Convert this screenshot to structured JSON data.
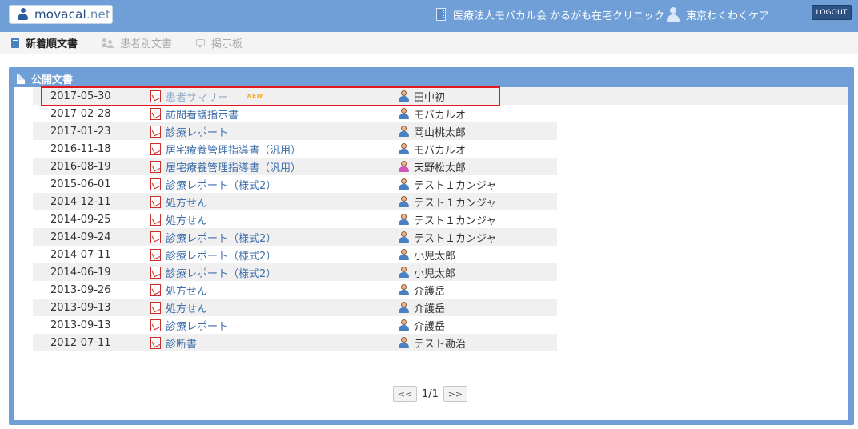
{
  "header": {
    "logo": {
      "name": "movacal",
      "dot": ".",
      "tld": "net"
    },
    "clinic_name": "医療法人モバカル会 かるがも在宅クリニック",
    "user_name": "東京わくわくケア",
    "logout_label": "LOGOUT"
  },
  "nav": {
    "tabs": [
      {
        "label": "新着順文書",
        "active": true,
        "icon": "document-icon"
      },
      {
        "label": "患者別文書",
        "active": false,
        "icon": "people-icon"
      },
      {
        "label": "掲示板",
        "active": false,
        "icon": "speech-bubble-icon"
      }
    ]
  },
  "panel": {
    "title": "公開文書"
  },
  "documents": [
    {
      "date": "2017-05-30",
      "title": "患者サマリー",
      "new": true,
      "badge": "NEW",
      "patient": "田中初",
      "gender": "male",
      "highlighted": true
    },
    {
      "date": "2017-02-28",
      "title": "訪問看護指示書",
      "new": false,
      "patient": "モバカルオ",
      "gender": "male"
    },
    {
      "date": "2017-01-23",
      "title": "診療レポート",
      "new": false,
      "patient": "岡山桃太郎",
      "gender": "male"
    },
    {
      "date": "2016-11-18",
      "title": "居宅療養管理指導書（汎用）",
      "new": false,
      "patient": "モバカルオ",
      "gender": "male"
    },
    {
      "date": "2016-08-19",
      "title": "居宅療養管理指導書（汎用）",
      "new": false,
      "patient": "天野松太郎",
      "gender": "female"
    },
    {
      "date": "2015-06-01",
      "title": "診療レポート（様式2）",
      "new": false,
      "patient": "テスト１カンジャ",
      "gender": "male"
    },
    {
      "date": "2014-12-11",
      "title": "処方せん",
      "new": false,
      "patient": "テスト１カンジャ",
      "gender": "male"
    },
    {
      "date": "2014-09-25",
      "title": "処方せん",
      "new": false,
      "patient": "テスト１カンジャ",
      "gender": "male"
    },
    {
      "date": "2014-09-24",
      "title": "診療レポート（様式2）",
      "new": false,
      "patient": "テスト１カンジャ",
      "gender": "male"
    },
    {
      "date": "2014-07-11",
      "title": "診療レポート（様式2）",
      "new": false,
      "patient": "小児太郎",
      "gender": "male"
    },
    {
      "date": "2014-06-19",
      "title": "診療レポート（様式2）",
      "new": false,
      "patient": "小児太郎",
      "gender": "male"
    },
    {
      "date": "2013-09-26",
      "title": "処方せん",
      "new": false,
      "patient": "介護岳",
      "gender": "male"
    },
    {
      "date": "2013-09-13",
      "title": "処方せん",
      "new": false,
      "patient": "介護岳",
      "gender": "male"
    },
    {
      "date": "2013-09-13",
      "title": "診療レポート",
      "new": false,
      "patient": "介護岳",
      "gender": "male"
    },
    {
      "date": "2012-07-11",
      "title": "診断書",
      "new": false,
      "patient": "テスト勘治",
      "gender": "male"
    }
  ],
  "pagination": {
    "prev_label": "<<",
    "page_text": "1/1",
    "next_label": ">>"
  },
  "colors": {
    "header_bg": "#6f9fd6",
    "logout_bg": "#2c5283",
    "link": "#3d6ea8",
    "highlight_border": "#e0171f",
    "new_badge": "#f5a623"
  }
}
